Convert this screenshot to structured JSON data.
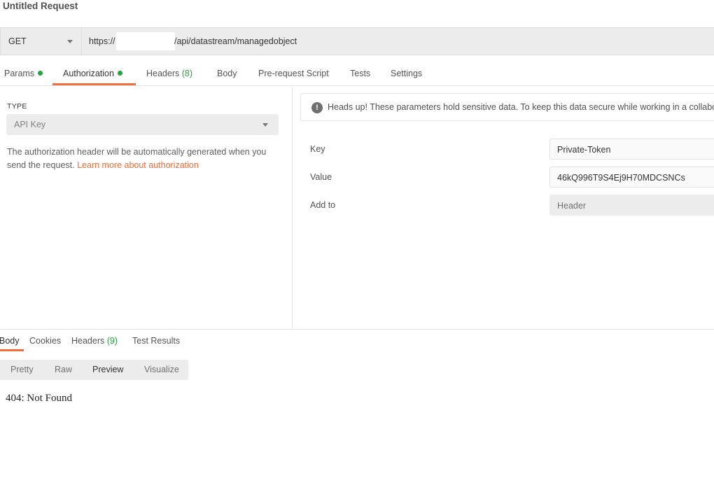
{
  "request": {
    "title": "Untitled Request",
    "method": "GET",
    "url_prefix": "https://",
    "url_suffix": "/api/datastream/managedobject"
  },
  "request_tabs": [
    {
      "label": "Params",
      "dot": true
    },
    {
      "label": "Authorization",
      "dot": true
    },
    {
      "label": "Headers",
      "count": "(8)"
    },
    {
      "label": "Body"
    },
    {
      "label": "Pre-request Script"
    },
    {
      "label": "Tests"
    },
    {
      "label": "Settings"
    }
  ],
  "auth": {
    "type_label": "TYPE",
    "type_value": "API Key",
    "help_text": "The authorization header will be automatically generated when you send the request.",
    "help_link": "Learn more about authorization",
    "warning_icon": "exclamation-circle-icon",
    "warning": "Heads up! These parameters hold sensitive data. To keep this data secure while working in a collaborative environment, we recommend using variables.",
    "fields": {
      "key_label": "Key",
      "key_value": "Private-Token",
      "value_label": "Value",
      "value_value": "46kQ996T9S4Ej9H70MDCSNCs",
      "addto_label": "Add to",
      "addto_value": "Header"
    }
  },
  "response_tabs": [
    {
      "label": "Body"
    },
    {
      "label": "Cookies"
    },
    {
      "label": "Headers",
      "count": "(9)"
    },
    {
      "label": "Test Results"
    }
  ],
  "view_modes": [
    "Pretty",
    "Raw",
    "Preview",
    "Visualize"
  ],
  "response_body": "404: Not Found",
  "colors": {
    "accent": "#f26b3a",
    "status_dot": "#27a243"
  }
}
